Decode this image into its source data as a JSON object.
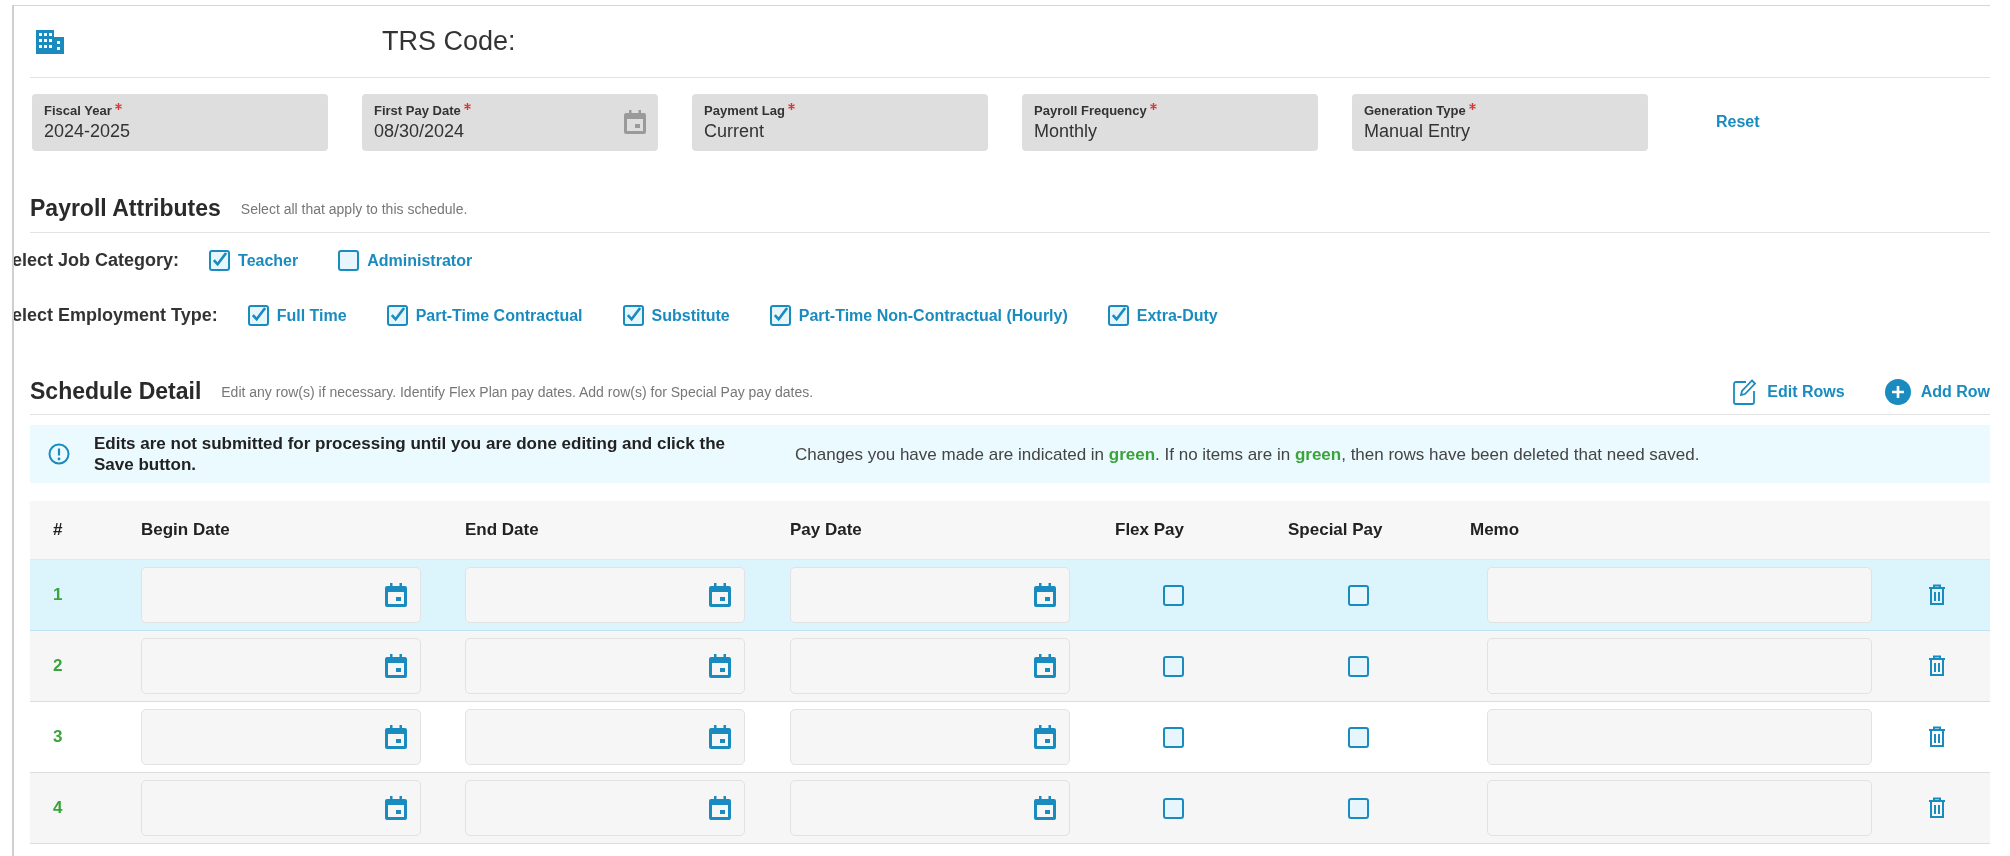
{
  "header": {
    "title": "TRS Code:"
  },
  "fields": [
    {
      "label": "Fiscal Year",
      "required": true,
      "value": "2024-2025",
      "kind": "text"
    },
    {
      "label": "First Pay Date",
      "required": true,
      "value": "08/30/2024",
      "kind": "date"
    },
    {
      "label": "Payment Lag",
      "required": true,
      "value": "Current",
      "kind": "text"
    },
    {
      "label": "Payroll Frequency",
      "required": true,
      "value": "Monthly",
      "kind": "text"
    },
    {
      "label": "Generation Type",
      "required": true,
      "value": "Manual Entry",
      "kind": "text"
    }
  ],
  "reset_link": "Reset",
  "payroll_attributes": {
    "title": "Payroll Attributes",
    "hint": "Select all that apply to this schedule.",
    "groups": [
      {
        "label": "elect Job Category:",
        "options": [
          {
            "label": "Teacher",
            "checked": true
          },
          {
            "label": "Administrator",
            "checked": false
          }
        ]
      },
      {
        "label": "elect Employment Type:",
        "options": [
          {
            "label": "Full Time",
            "checked": true
          },
          {
            "label": "Part-Time Contractual",
            "checked": true
          },
          {
            "label": "Substitute",
            "checked": true
          },
          {
            "label": "Part-Time Non-Contractual (Hourly)",
            "checked": true
          },
          {
            "label": "Extra-Duty",
            "checked": true
          }
        ]
      }
    ]
  },
  "schedule_detail": {
    "title": "Schedule Detail",
    "hint": "Edit any row(s) if necessary. Identify Flex Plan pay dates. Add row(s) for Special Pay pay dates.",
    "actions": [
      {
        "label": "Edit Rows",
        "kind": "edit"
      },
      {
        "label": "Add Row",
        "kind": "add"
      }
    ],
    "notice": {
      "warning": "Edits are not submitted for processing until you are done editing and click the Save button.",
      "info": "Changes you have made are indicated in **green**. If no items are in **green**, then rows have been deleted that need saved."
    },
    "table": {
      "columns": [
        "#",
        "Begin Date",
        "End Date",
        "Pay Date",
        "Flex Pay",
        "Special Pay",
        "Memo"
      ],
      "rows": [
        {
          "number": "1",
          "selected": true,
          "flex_pay": false,
          "special_pay": false
        },
        {
          "number": "2",
          "selected": false,
          "flex_pay": false,
          "special_pay": false
        },
        {
          "number": "3",
          "selected": false,
          "flex_pay": false,
          "special_pay": false
        },
        {
          "number": "4",
          "selected": false,
          "flex_pay": false,
          "special_pay": false
        }
      ]
    }
  }
}
